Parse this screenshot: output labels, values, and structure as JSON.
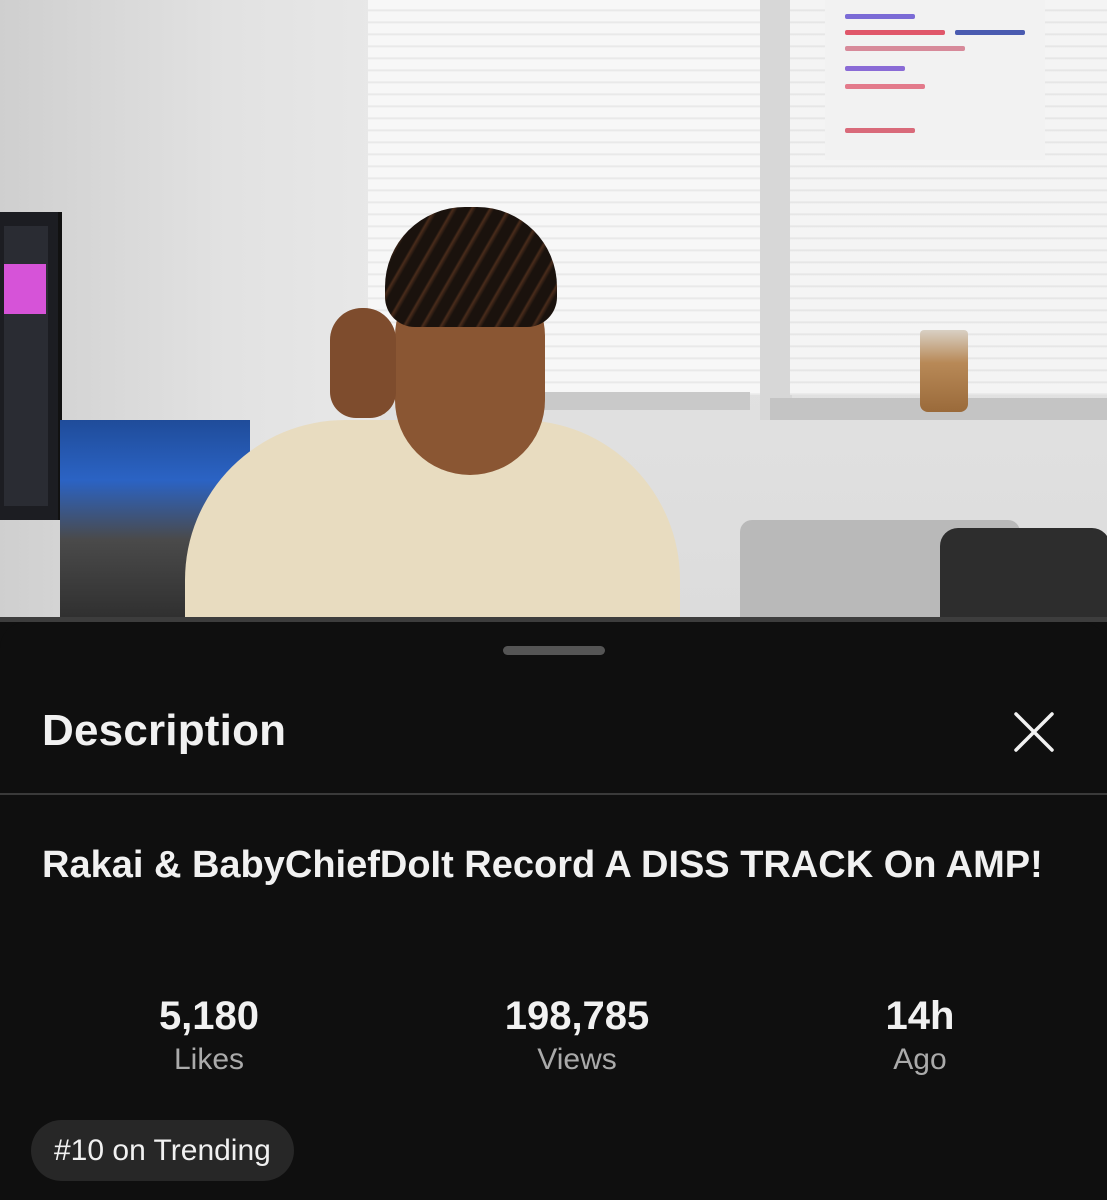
{
  "video": {
    "thumbnail": "video-frame"
  },
  "sheet": {
    "header_title": "Description",
    "close_icon": "close-icon"
  },
  "details": {
    "title": "Rakai & BabyChiefDoIt Record A DISS TRACK On AMP!",
    "stats": [
      {
        "value": "5,180",
        "label": "Likes"
      },
      {
        "value": "198,785",
        "label": "Views"
      },
      {
        "value": "14h",
        "label": "Ago"
      }
    ],
    "trending_chip": "#10 on Trending"
  },
  "colors": {
    "background": "#0f0f0f",
    "text_primary": "#f1f1f1",
    "text_secondary": "#aaaaaa",
    "chip_bg": "#272727"
  }
}
